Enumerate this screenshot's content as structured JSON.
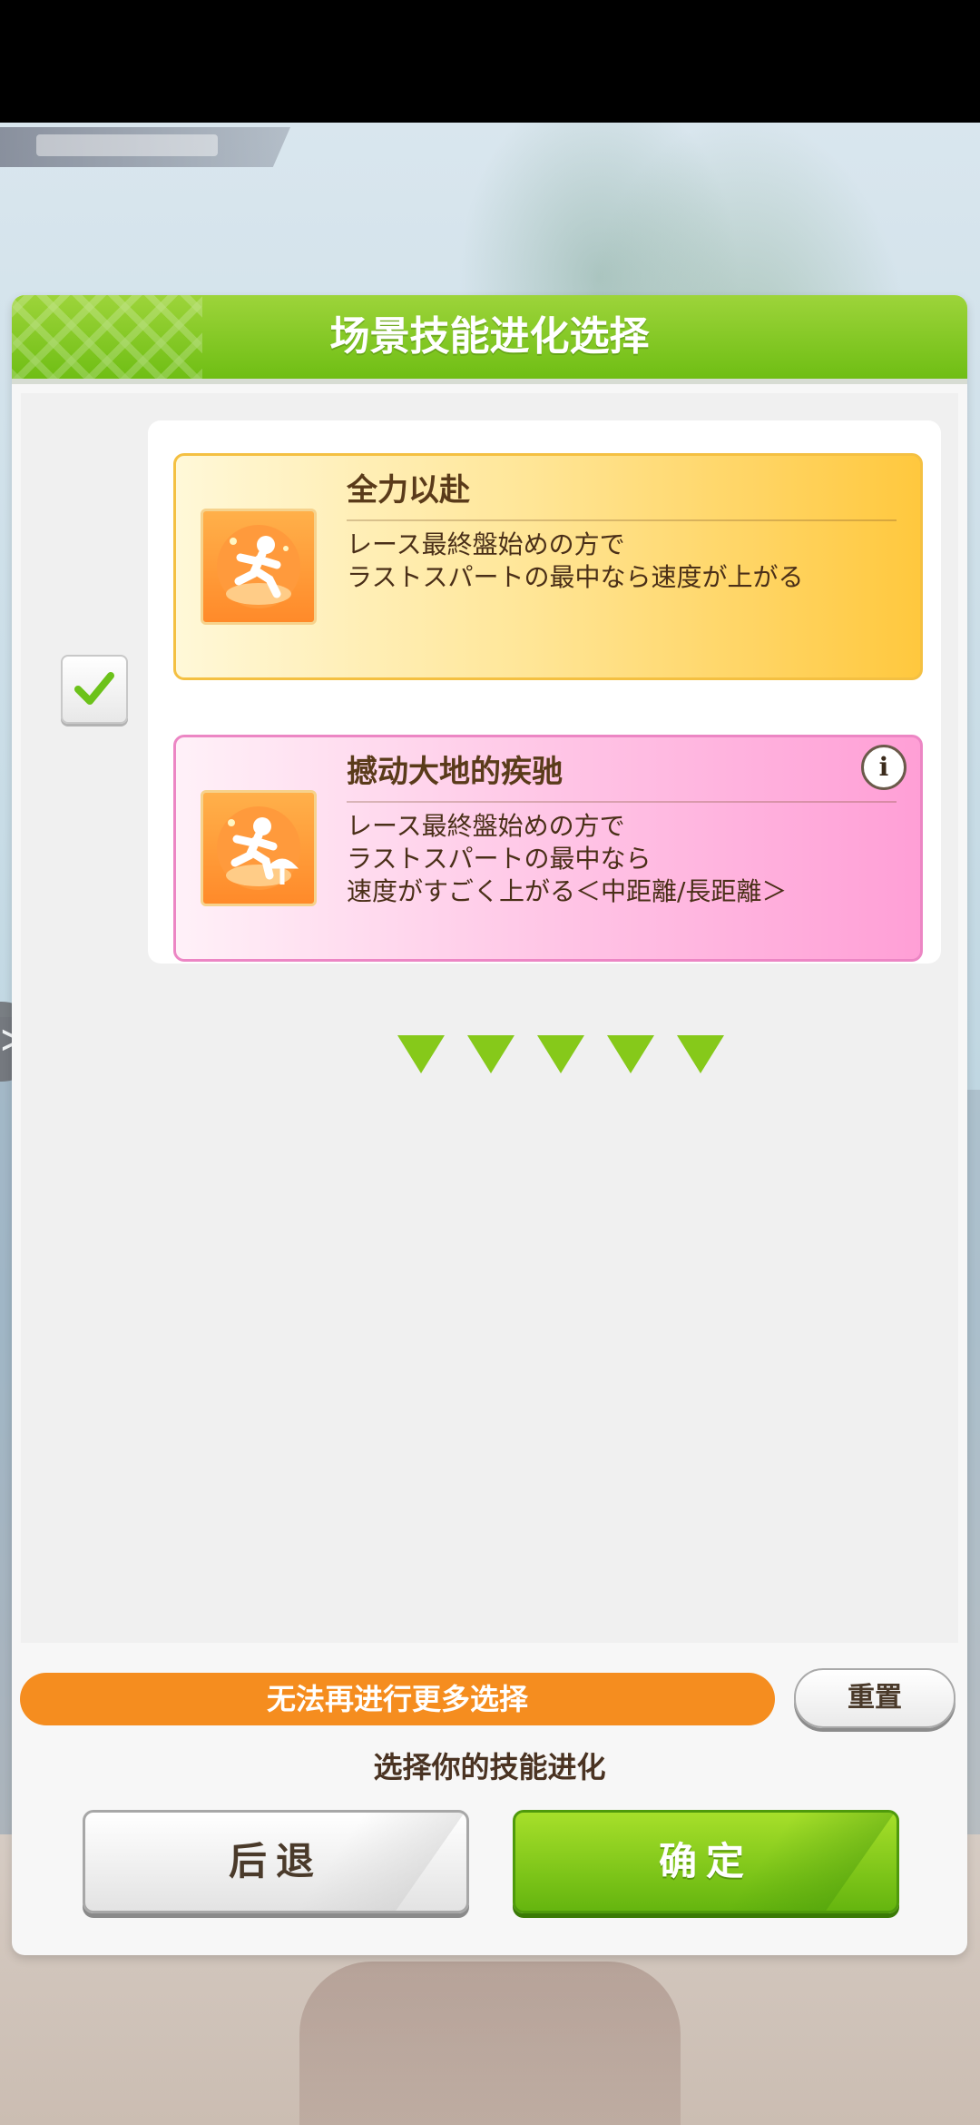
{
  "dialog": {
    "title": "场景技能进化选择"
  },
  "skills": [
    {
      "name": "全力以赴",
      "description": [
        "レース最終盤始めの方で",
        "ラストスパートの最中なら速度が上がる"
      ],
      "color": "#ffc83e",
      "icon": "running-figure-icon"
    },
    {
      "name": "撼动大地的疾驰",
      "description": [
        "レース最終盤始めの方で",
        "ラストスパートの最中なら",
        "速度がすごく上がる＜中距離/長距離＞"
      ],
      "color": "#ff9fd6",
      "icon": "running-figure-evolved-icon"
    }
  ],
  "selection": {
    "checked": true
  },
  "status": {
    "limit_message": "无法再进行更多选择"
  },
  "buttons": {
    "reset": "重置",
    "back": "后退",
    "confirm": "确定"
  },
  "instruction": "选择你的技能进化",
  "colors": {
    "accent_green": "#7cc51c",
    "banner_orange": "#f58d1f"
  }
}
